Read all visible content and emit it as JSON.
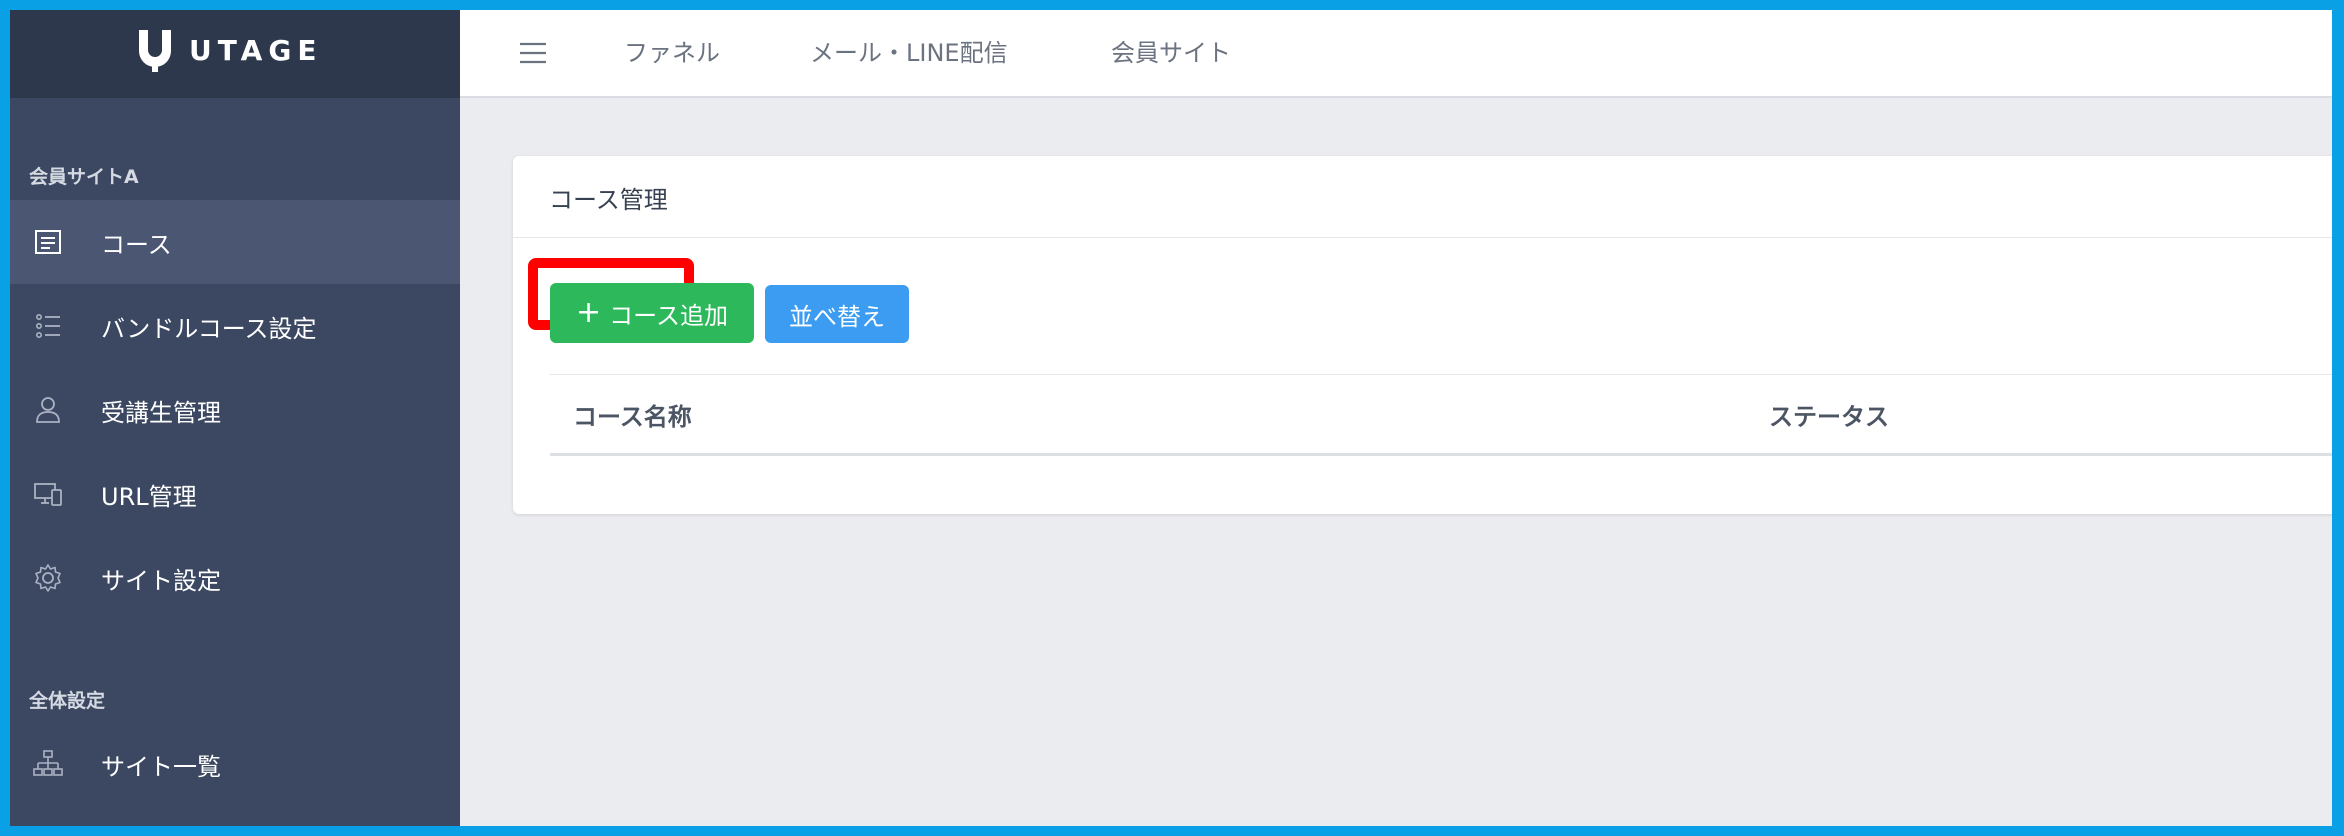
{
  "brand": {
    "name": "UTAGE"
  },
  "sidebar": {
    "sections": [
      {
        "label": "会員サイトA",
        "items": [
          {
            "label": "コース",
            "icon": "document-lines-icon",
            "active": true
          },
          {
            "label": "バンドルコース設定",
            "icon": "list-icon",
            "active": false
          },
          {
            "label": "受講生管理",
            "icon": "user-icon",
            "active": false
          },
          {
            "label": "URL管理",
            "icon": "devices-icon",
            "active": false
          },
          {
            "label": "サイト設定",
            "icon": "gear-icon",
            "active": false
          }
        ]
      },
      {
        "label": "全体設定",
        "items": [
          {
            "label": "サイト一覧",
            "icon": "sitemap-icon",
            "active": false
          }
        ]
      }
    ]
  },
  "topbar": {
    "menu_icon": "hamburger-icon",
    "nav": [
      "ファネル",
      "メール・LINE配信",
      "会員サイト"
    ]
  },
  "card": {
    "title": "コース管理",
    "buttons": {
      "add_label": "コース追加",
      "add_icon": "plus-icon",
      "sort_label": "並べ替え"
    },
    "table": {
      "columns": [
        "コース名称",
        "ステータス"
      ],
      "rows": []
    }
  },
  "colors": {
    "sidebar_bg": "#3c4862",
    "sidebar_header_bg": "#2e384c",
    "sidebar_active_bg": "#4a5672",
    "add_button": "#2db85b",
    "sort_button": "#3b9cf2",
    "highlight": "#ff0000",
    "frame_border": "#0aa0e6"
  }
}
